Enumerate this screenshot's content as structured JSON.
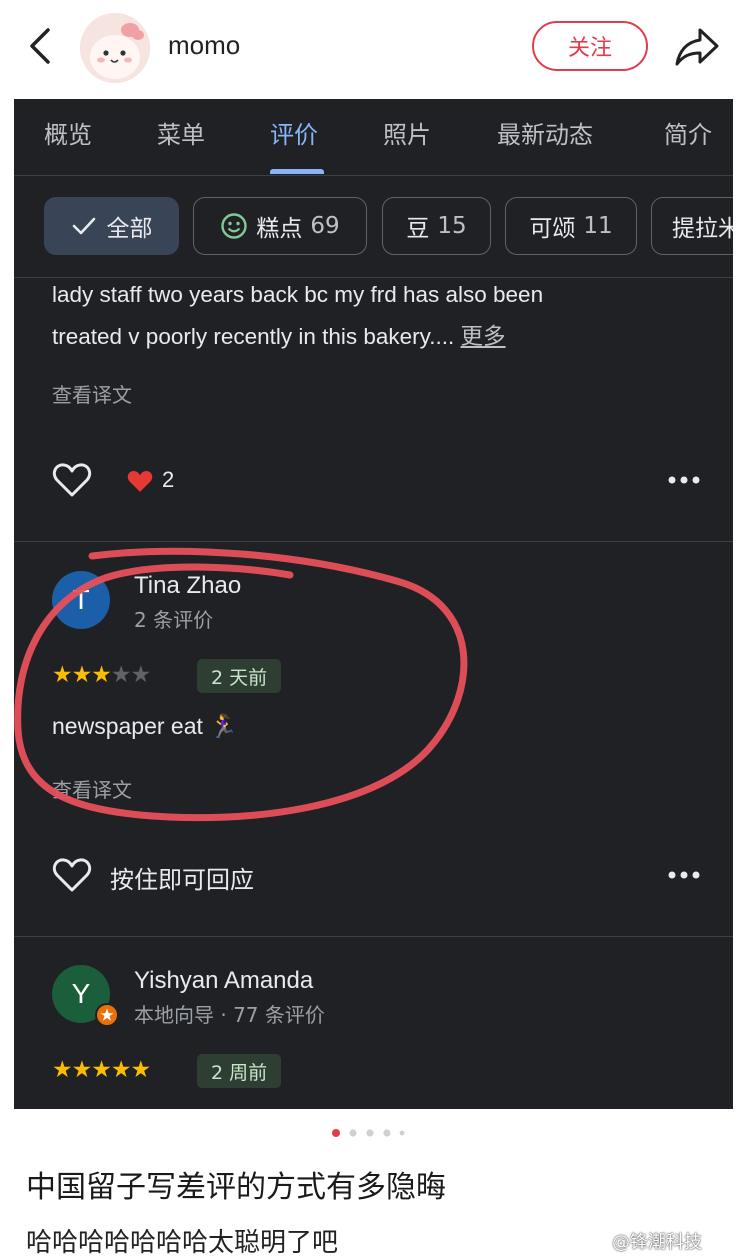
{
  "header": {
    "username": "momo",
    "follow_label": "关注"
  },
  "tabs": [
    "概览",
    "菜单",
    "评价",
    "照片",
    "最新动态",
    "简介"
  ],
  "active_tab": "评价",
  "filters": [
    {
      "label": "全部",
      "count": ""
    },
    {
      "label": "糕点",
      "count": "69"
    },
    {
      "label": "豆",
      "count": "15"
    },
    {
      "label": "可颂",
      "count": "11"
    },
    {
      "label": "提拉米",
      "count": ""
    }
  ],
  "review_prev": {
    "text_line1": "lady staff two years back bc my frd has also been",
    "text_line2": "treated v poorly recently in this bakery....",
    "more_label": "更多",
    "translate_label": "查看译文",
    "reaction_count": "2"
  },
  "review_tina": {
    "avatar_letter": "T",
    "name": "Tina Zhao",
    "meta": "2 条评价",
    "rating": 3,
    "time": "2 天前",
    "text": "newspaper eat",
    "emoji": "🏃‍♀️",
    "translate_label": "查看译文",
    "react_label": "按住即可回应"
  },
  "review_yishyan": {
    "avatar_letter": "Y",
    "name": "Yishyan Amanda",
    "meta": "本地向导 · 77 条评价",
    "rating": 5,
    "time": "2 周前"
  },
  "post": {
    "title": "中国留子写差评的方式有多隐晦",
    "body": "哈哈哈哈哈哈哈太聪明了吧",
    "watermark": "@锋潮科技"
  },
  "colors": {
    "accent_red": "#e23b4a",
    "dark_bg": "#202124",
    "tab_active": "#8ab4f8",
    "star": "#fbbc04",
    "annotation": "#e8505b"
  }
}
